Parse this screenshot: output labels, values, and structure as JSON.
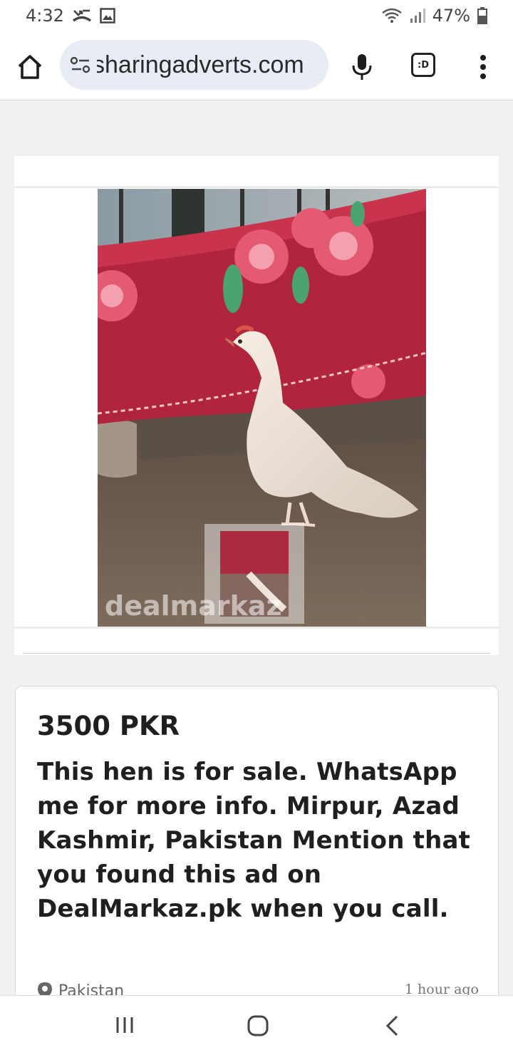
{
  "status_bar": {
    "time": "4:32",
    "battery": "47%",
    "icons": [
      "missed-call-icon",
      "image-icon",
      "wifi-icon",
      "signal-icon",
      "battery-icon"
    ]
  },
  "browser": {
    "url": "sharingadverts.com",
    "tab_count": ":D",
    "icons": [
      "home-icon",
      "site-settings-icon",
      "mic-icon",
      "more-vert-icon"
    ]
  },
  "listing": {
    "image_watermark": "dealmarkaz",
    "price": "3500 PKR",
    "description": "This hen is for sale. WhatsApp me for more info. Mirpur, Azad Kashmir, Pakistan Mention that you found this ad on DealMarkaz.pk when you call.",
    "location": "Pakistan",
    "posted": "1 hour ago"
  },
  "nav": {
    "icons": [
      "recents-icon",
      "home-nav-icon",
      "back-icon"
    ]
  }
}
